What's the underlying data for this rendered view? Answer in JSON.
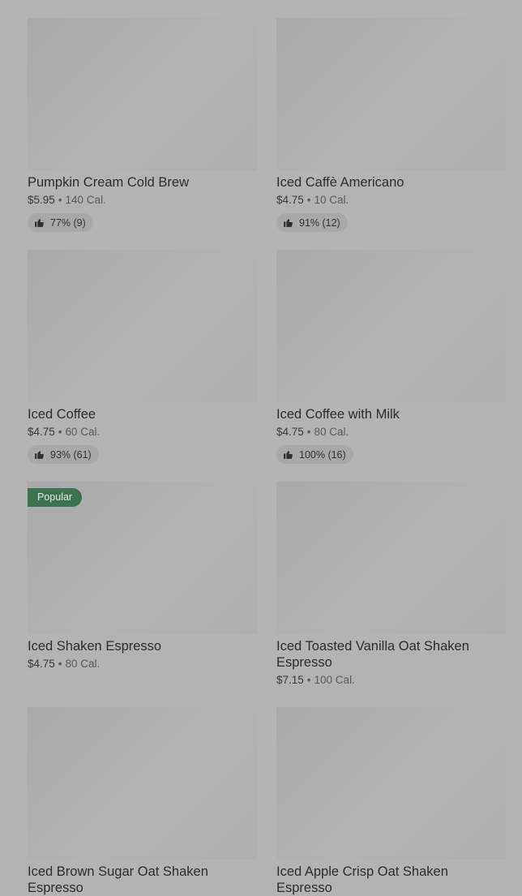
{
  "products": [
    {
      "name": "Pumpkin Cream Cold Brew",
      "price": "$5.95",
      "calories": "140 Cal.",
      "rating": "77% (9)",
      "badge": ""
    },
    {
      "name": "Iced Caffè Americano",
      "price": "$4.75",
      "calories": "10 Cal.",
      "rating": "91% (12)",
      "badge": ""
    },
    {
      "name": "Iced Coffee",
      "price": "$4.75",
      "calories": "60 Cal.",
      "rating": "93% (61)",
      "badge": ""
    },
    {
      "name": "Iced Coffee with Milk",
      "price": "$4.75",
      "calories": "80 Cal.",
      "rating": "100% (16)",
      "badge": ""
    },
    {
      "name": "Iced Shaken Espresso",
      "price": "$4.75",
      "calories": "80 Cal.",
      "rating": "",
      "badge": "Popular"
    },
    {
      "name": "Iced Toasted Vanilla Oat Shaken Espresso",
      "price": "$7.15",
      "calories": "100 Cal.",
      "rating": "",
      "badge": ""
    },
    {
      "name": "Iced Brown Sugar Oat Shaken Espresso",
      "price": "",
      "calories": "",
      "rating": "",
      "badge": ""
    },
    {
      "name": "Iced Apple Crisp Oat Shaken Espresso",
      "price": "",
      "calories": "",
      "rating": "",
      "badge": ""
    }
  ],
  "separator": "•",
  "icons": {
    "rating": "thumbs-up-icon"
  },
  "colors": {
    "badge_bg": "#3d7250",
    "overlay": "#b3b3b3"
  }
}
